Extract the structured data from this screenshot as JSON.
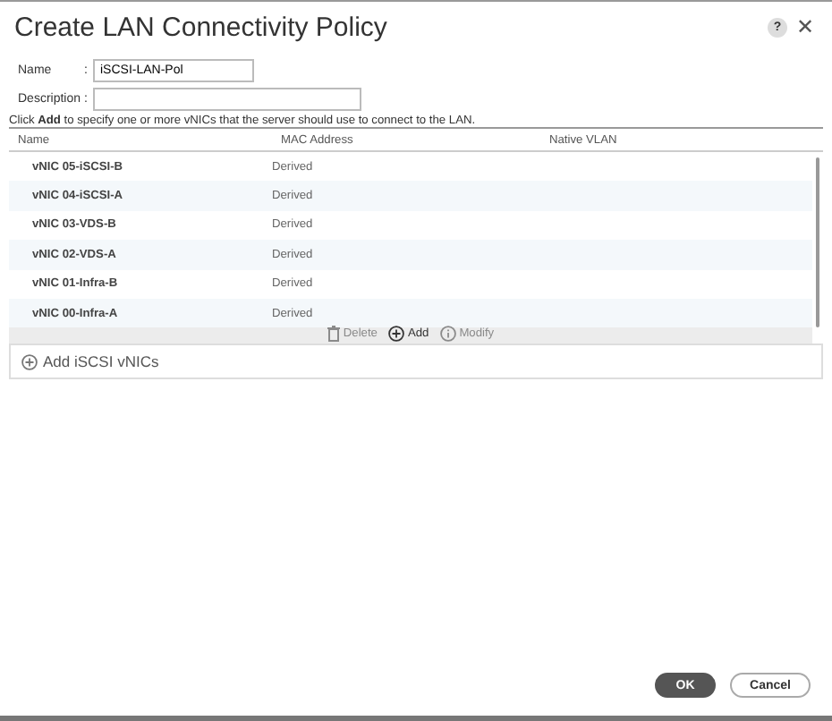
{
  "window": {
    "title": "Create LAN Connectivity Policy",
    "help": "?",
    "close": "✕"
  },
  "fields": [
    {
      "label": "Name",
      "separator": ":",
      "value": "iSCSI-LAN-Pol"
    },
    {
      "label": "Description",
      "separator": ":"
    }
  ],
  "instruction": "Click **Add** to specify one or more vNICs that the server should use to connect to the LAN.",
  "table": {
    "columns": [
      "Name",
      "MAC Address",
      "Native VLAN"
    ],
    "rows": [
      {
        "name": "vNIC 05-iSCSI-B",
        "mac": "Derived"
      },
      {
        "name": "vNIC 04-iSCSI-A",
        "mac": "Derived"
      },
      {
        "name": "vNIC 03-VDS-B",
        "mac": "Derived"
      },
      {
        "name": "vNIC 02-VDS-A",
        "mac": "Derived"
      },
      {
        "name": "vNIC 01-Infra-B",
        "mac": "Derived"
      },
      {
        "name": "vNIC 00-Infra-A",
        "mac": "Derived"
      }
    ],
    "actions": [
      {
        "label": "Delete",
        "disabled": true,
        "kind": "trash"
      },
      {
        "label": "Add",
        "disabled": false,
        "kind": "plus"
      },
      {
        "label": "Modify",
        "disabled": true,
        "kind": "info"
      }
    ]
  },
  "iscsi": {
    "label": "Add iSCSI vNICs"
  },
  "buttons": [
    {
      "label": "OK",
      "primary": true
    },
    {
      "label": "Cancel",
      "primary": false
    }
  ]
}
